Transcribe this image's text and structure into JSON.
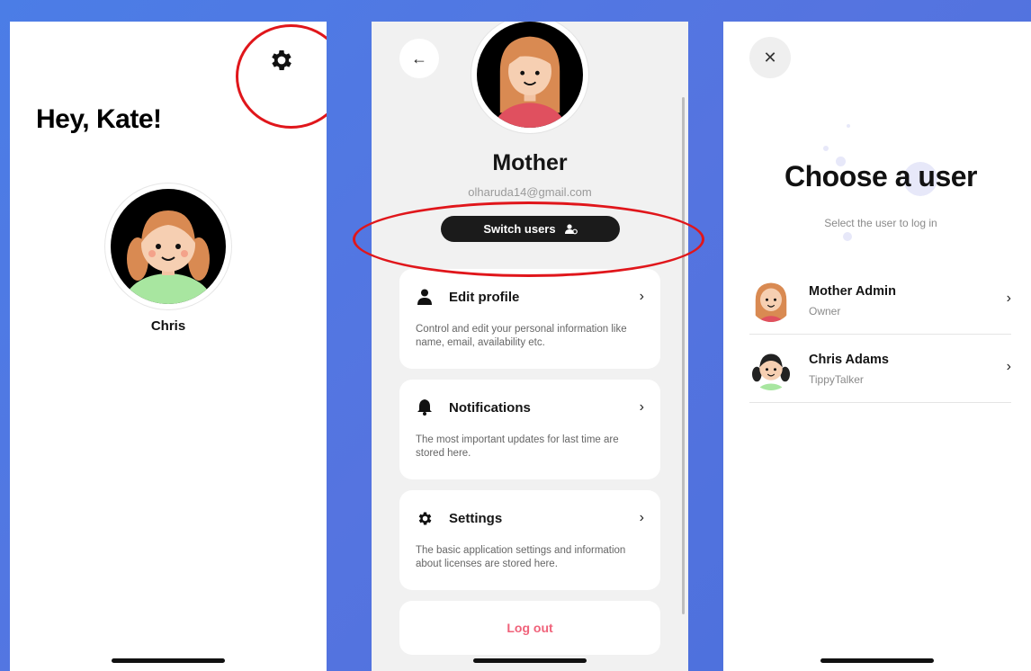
{
  "screen_home": {
    "greeting": "Hey, Kate!",
    "child_name": "Chris"
  },
  "screen_profile": {
    "back_icon": "←",
    "name": "Mother",
    "email": "olharuda14@gmail.com",
    "switch_users_label": "Switch users",
    "menu": [
      {
        "title": "Edit profile",
        "description": "Control and edit your personal information like name, email, availability etc.",
        "icon": "person-icon"
      },
      {
        "title": "Notifications",
        "description": "The most important updates for last time are stored here.",
        "icon": "bell-icon"
      },
      {
        "title": "Settings",
        "description": "The basic application settings and information about licenses are stored here.",
        "icon": "gear-icon"
      }
    ],
    "chevron": "›",
    "logout_label": "Log out"
  },
  "screen_choose": {
    "close_icon": "✕",
    "title": "Choose a user",
    "subtitle": "Select the user to log in",
    "users": [
      {
        "name": "Mother Admin",
        "role": "Owner"
      },
      {
        "name": "Chris Adams",
        "role": "TippyTalker"
      }
    ],
    "chevron": "›"
  },
  "colors": {
    "background": "#4b7de6",
    "annotation_red": "#e0161b",
    "logout_pink": "#f0627a",
    "dark_button": "#1b1b1b"
  }
}
